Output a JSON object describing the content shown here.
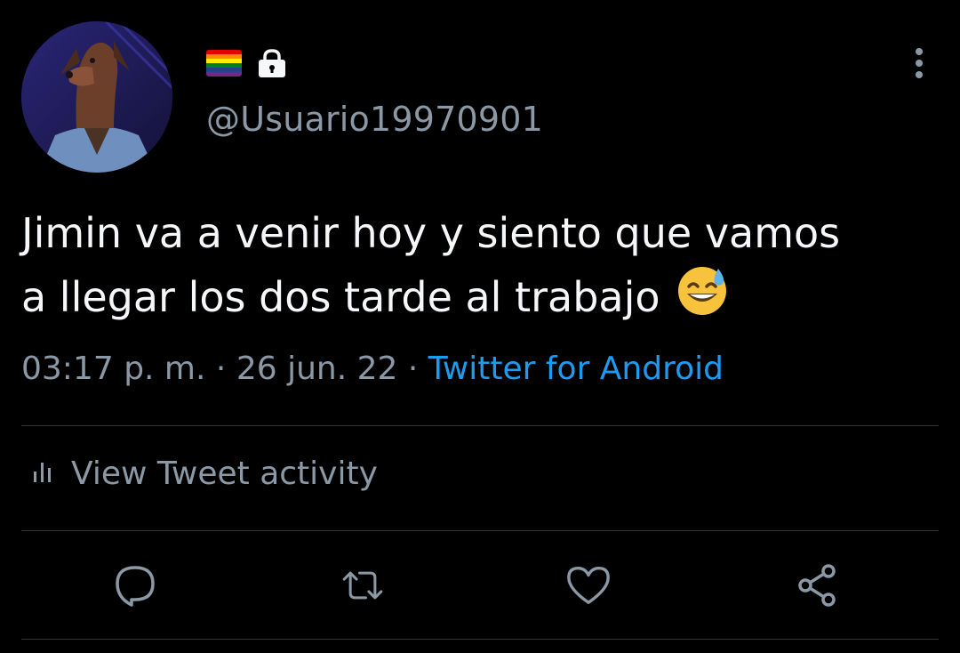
{
  "user": {
    "handle": "@Usuario19970901",
    "avatar_icon": "doberman-avatar",
    "flag_icon": "rainbow-flag-icon",
    "lock_icon": "lock-icon"
  },
  "tweet": {
    "text_line_1": "Jimin va a venir hoy y siento que vamos",
    "text_line_2": "a llegar los dos tarde al trabajo",
    "emoji": "grinning-face-with-sweat-emoji"
  },
  "meta": {
    "time": "03:17 p. m.",
    "separator": "·",
    "date": "26 jun. 22",
    "source": "Twitter for Android"
  },
  "activity": {
    "label": "View Tweet activity"
  },
  "actions": {
    "reply_icon": "reply-icon",
    "retweet_icon": "retweet-icon",
    "like_icon": "heart-icon",
    "share_icon": "share-icon"
  },
  "colors": {
    "background": "#000000",
    "text_primary": "#f5f7f8",
    "text_secondary": "#8b98a5",
    "link": "#1d9bf0",
    "divider": "#2f3336"
  }
}
